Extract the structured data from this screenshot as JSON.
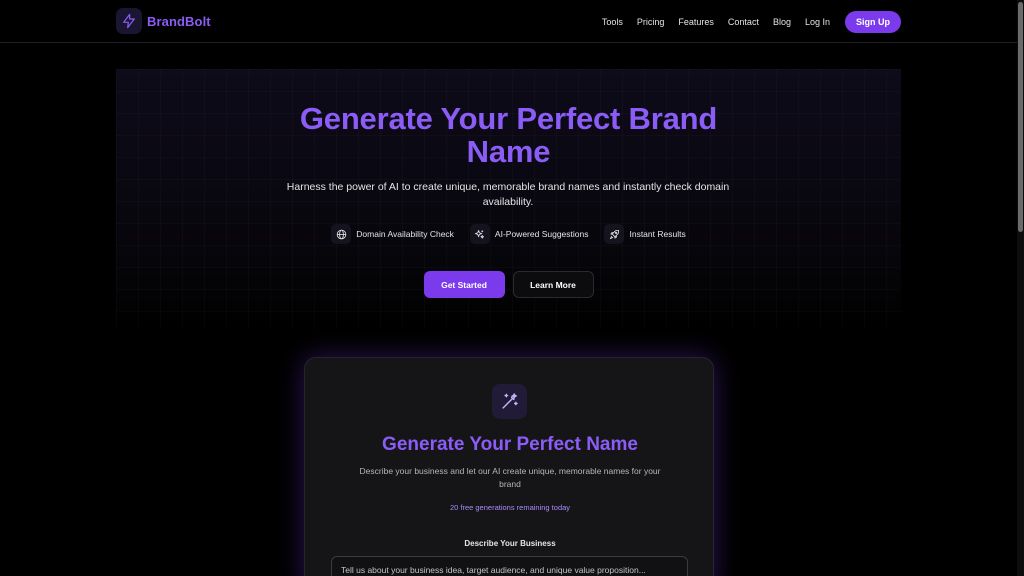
{
  "brand": {
    "name": "BrandBolt",
    "icon": "lightning-bolt-icon",
    "accent_color": "#8b5cf6"
  },
  "nav": {
    "links": [
      "Tools",
      "Pricing",
      "Features",
      "Contact",
      "Blog",
      "Log In"
    ],
    "signup_label": "Sign Up"
  },
  "hero": {
    "title_line1": "Generate Your Perfect Brand",
    "title_line2": "Name",
    "subtitle": "Harness the power of AI to create unique, memorable brand names and instantly check domain availability.",
    "features": [
      {
        "icon": "globe-icon",
        "label": "Domain Availability Check"
      },
      {
        "icon": "sparkles-icon",
        "label": "AI-Powered Suggestions"
      },
      {
        "icon": "rocket-icon",
        "label": "Instant Results"
      }
    ],
    "primary_button": "Get Started",
    "secondary_button": "Learn More"
  },
  "generator": {
    "icon": "magic-wand-icon",
    "title": "Generate Your Perfect Name",
    "description": "Describe your business and let our AI create unique, memorable names for your brand",
    "remaining": "20 free generations remaining today",
    "field_label": "Describe Your Business",
    "field_placeholder": "Tell us about your business idea, target audience, and unique value proposition..."
  }
}
